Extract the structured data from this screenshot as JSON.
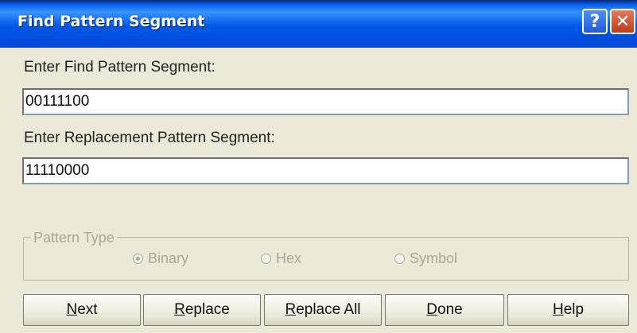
{
  "window": {
    "title": "Find Pattern Segment",
    "help_glyph": "?",
    "close_glyph": "✕"
  },
  "find": {
    "label": "Enter Find Pattern Segment:",
    "value": "00111100"
  },
  "replace": {
    "label": "Enter Replacement Pattern Segment:",
    "value": "11110000"
  },
  "pattern_type": {
    "legend": "Pattern Type",
    "options": [
      {
        "label": "Binary",
        "selected": true
      },
      {
        "label": "Hex",
        "selected": false
      },
      {
        "label": "Symbol",
        "selected": false
      }
    ],
    "enabled": false
  },
  "buttons": {
    "next": {
      "mnemonic": "N",
      "rest": "ext"
    },
    "replace": {
      "mnemonic": "R",
      "rest": "eplace"
    },
    "replace_all": {
      "mnemonic": "R",
      "rest": "eplace All"
    },
    "done": {
      "mnemonic": "D",
      "rest": "one"
    },
    "help": {
      "mnemonic": "H",
      "rest": "elp"
    }
  },
  "colors": {
    "titlebar": "#0058e6",
    "dialog_bg": "#ece9d8",
    "disabled_text": "#aca899"
  }
}
